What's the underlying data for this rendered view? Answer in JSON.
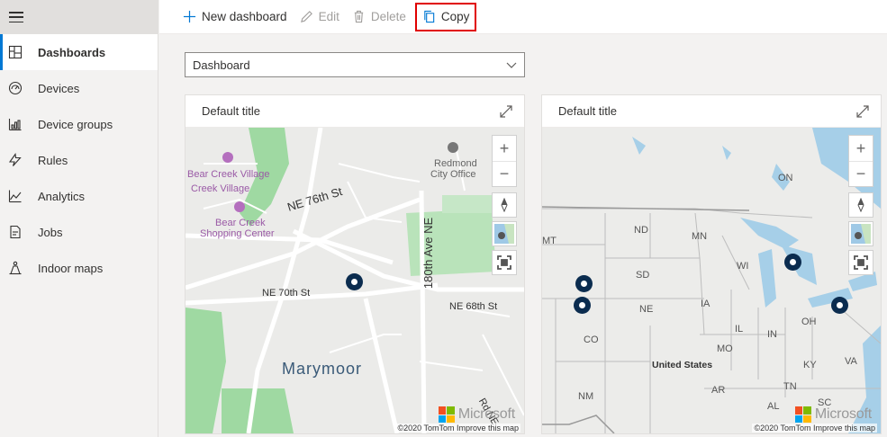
{
  "commands": {
    "new_dashboard": "New dashboard",
    "edit": "Edit",
    "delete": "Delete",
    "copy": "Copy"
  },
  "sidebar": {
    "items": [
      {
        "label": "Dashboards",
        "icon": "dashboard-icon",
        "active": true
      },
      {
        "label": "Devices",
        "icon": "devices-icon"
      },
      {
        "label": "Device groups",
        "icon": "device-groups-icon"
      },
      {
        "label": "Rules",
        "icon": "rules-icon"
      },
      {
        "label": "Analytics",
        "icon": "analytics-icon"
      },
      {
        "label": "Jobs",
        "icon": "jobs-icon"
      },
      {
        "label": "Indoor maps",
        "icon": "indoor-maps-icon"
      }
    ]
  },
  "dashboard_select": {
    "value": "Dashboard"
  },
  "tiles": [
    {
      "title": "Default title",
      "map_labels": [
        "Bear Creek Village",
        "Creek Village",
        "Bear Creek",
        "Shopping Center",
        "NE 76th St",
        "Redmond",
        "City Office",
        "180th Ave NE",
        "NE 70th St",
        "NE 68th St",
        "Marymoor",
        "Rd NE"
      ],
      "brand": "Microsoft",
      "attribution": "©2020 TomTom  Improve this map"
    },
    {
      "title": "Default title",
      "map_labels": [
        "ON",
        "MT",
        "ND",
        "MN",
        "SD",
        "WI",
        "IA",
        "NE",
        "IL",
        "IN",
        "OH",
        "CO",
        "MO",
        "United States",
        "KY",
        "VA",
        "NM",
        "AR",
        "TN",
        "AL",
        "SC"
      ],
      "brand": "Microsoft",
      "attribution": "©2020 TomTom  Improve this map"
    }
  ],
  "colors": {
    "accent": "#0078d4",
    "highlight": "#e00000",
    "marker": "#0b2c4f",
    "water": "#a6cfe8",
    "park": "#9fd9a2"
  }
}
